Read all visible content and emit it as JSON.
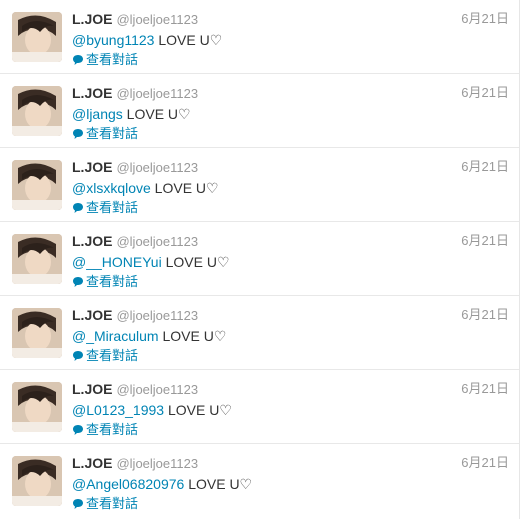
{
  "colors": {
    "link": "#0084b4",
    "name": "#333333",
    "meta": "#999999"
  },
  "tweets": [
    {
      "fullname": "L.JOE",
      "username": "@ljoeljoe1123",
      "time": "6月21日",
      "mention": "@byung1123",
      "text": " LOVE U♡",
      "conversation": "查看對話",
      "avatar_icon": "profile-photo"
    },
    {
      "fullname": "L.JOE",
      "username": "@ljoeljoe1123",
      "time": "6月21日",
      "mention": "@ljangs",
      "text": " LOVE U♡",
      "conversation": "查看對話",
      "avatar_icon": "profile-photo"
    },
    {
      "fullname": "L.JOE",
      "username": "@ljoeljoe1123",
      "time": "6月21日",
      "mention": "@xlsxkqlove",
      "text": " LOVE U♡",
      "conversation": "查看對話",
      "avatar_icon": "profile-photo"
    },
    {
      "fullname": "L.JOE",
      "username": "@ljoeljoe1123",
      "time": "6月21日",
      "mention": "@__HONEYui",
      "text": " LOVE U♡",
      "conversation": "查看對話",
      "avatar_icon": "profile-photo"
    },
    {
      "fullname": "L.JOE",
      "username": "@ljoeljoe1123",
      "time": "6月21日",
      "mention": "@_Miraculum",
      "text": " LOVE U♡",
      "conversation": "查看對話",
      "avatar_icon": "profile-photo"
    },
    {
      "fullname": "L.JOE",
      "username": "@ljoeljoe1123",
      "time": "6月21日",
      "mention": "@L0123_1993",
      "text": " LOVE U♡",
      "conversation": "查看對話",
      "avatar_icon": "profile-photo"
    },
    {
      "fullname": "L.JOE",
      "username": "@ljoeljoe1123",
      "time": "6月21日",
      "mention": "@Angel06820976",
      "text": " LOVE U♡",
      "conversation": "查看對話",
      "avatar_icon": "profile-photo"
    }
  ]
}
